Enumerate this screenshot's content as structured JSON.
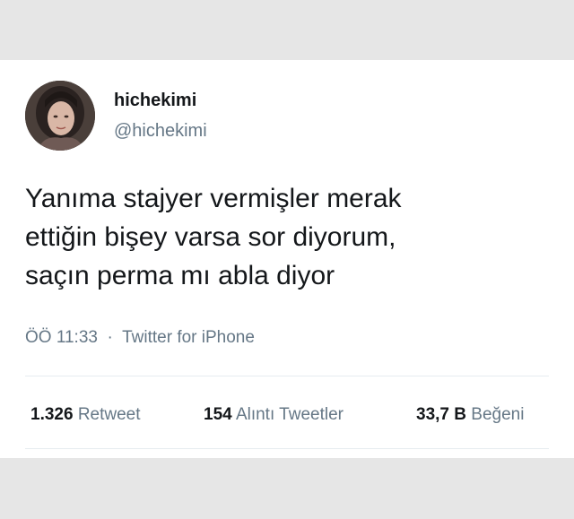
{
  "user": {
    "display_name": "hichekimi",
    "handle": "@hichekimi"
  },
  "tweet": {
    "text": "Yanıma stajyer vermişler merak\nettiğin bişey varsa sor diyorum,\nsaçın perma mı abla diyor",
    "time": "ÖÖ 11:33",
    "separator": "·",
    "source": "Twitter for iPhone"
  },
  "stats": {
    "retweets": {
      "count": "1.326",
      "label": "Retweet"
    },
    "quotes": {
      "count": "154",
      "label": "Alıntı Tweetler"
    },
    "likes": {
      "count": "33,7 B",
      "label": "Beğeni"
    }
  },
  "colors": {
    "background": "#e6e6e6",
    "card": "#ffffff",
    "text": "#14171a",
    "secondary": "#657786"
  },
  "icons": {
    "avatar": "user-profile-photo"
  }
}
